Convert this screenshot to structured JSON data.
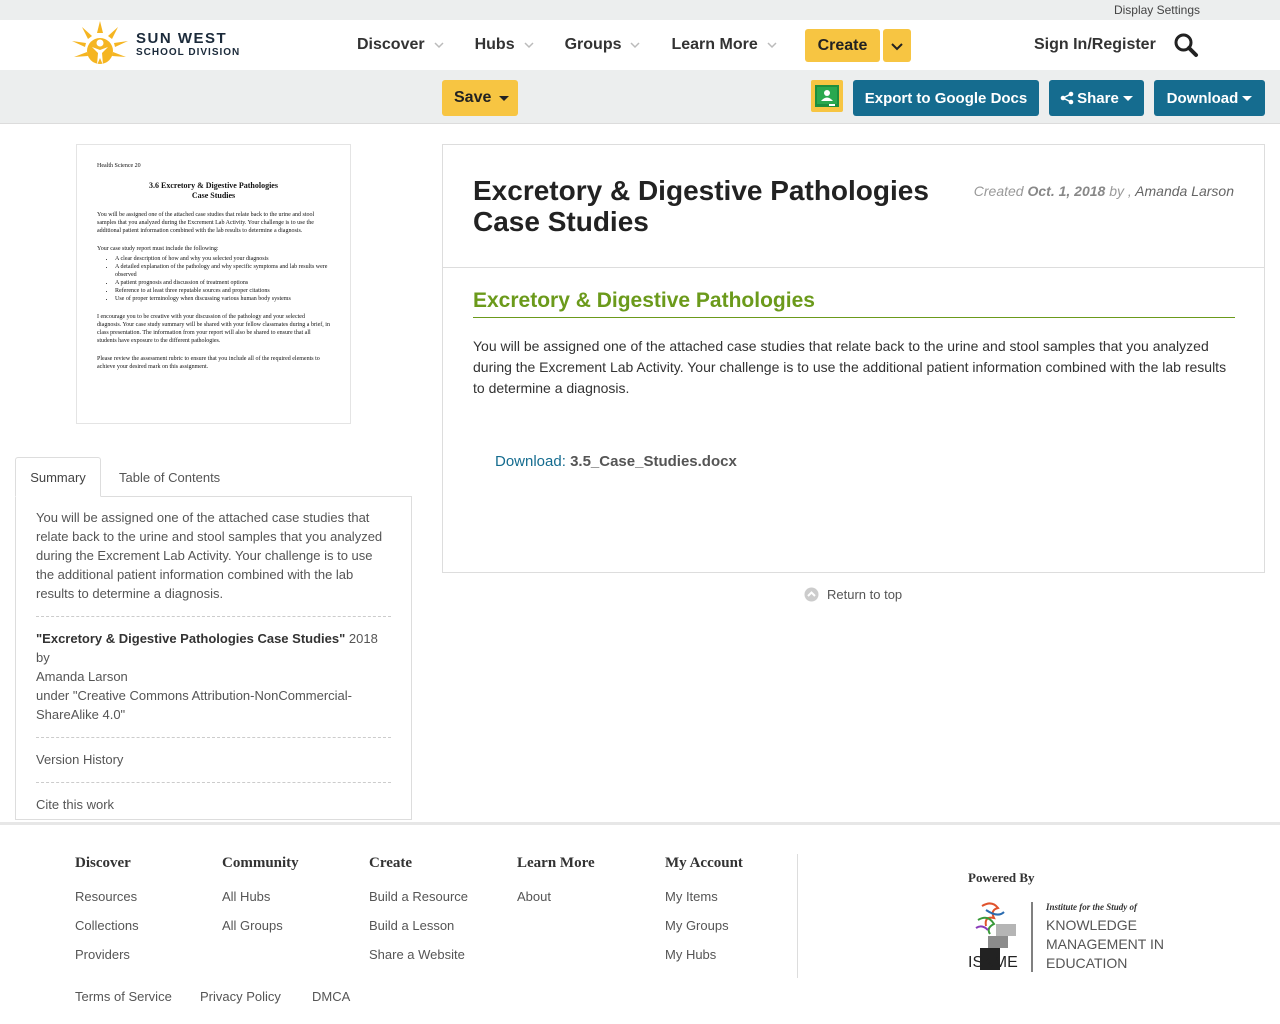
{
  "topbar": {
    "display_settings": "Display Settings"
  },
  "header": {
    "logo": {
      "line1": "SUN WEST",
      "line2": "SCHOOL DIVISION"
    },
    "nav": [
      "Discover",
      "Hubs",
      "Groups",
      "Learn More"
    ],
    "create": "Create",
    "signin": "Sign In/Register"
  },
  "toolbar": {
    "save": "Save",
    "export": "Export to Google Docs",
    "share": "Share",
    "download": "Download"
  },
  "thumbnail": {
    "course": "Health Science 20",
    "title_line1": "3.6 Excretory & Digestive Pathologies",
    "title_line2": "Case Studies",
    "para1": "You will be assigned one of the attached case studies that relate back to the urine and stool samples that you analyzed during the Excrement Lab Activity. Your challenge is to use the additional patient information combined with the lab results to determine a diagnosis.",
    "list_intro": "Your case study report must include the following:",
    "list": [
      "A clear description of how and why you selected your diagnosis",
      "A detailed explanation of the pathology and why specific symptoms and lab results were observed",
      "A patient prognosis and discussion of treatment options",
      "Reference to at least three reputable sources and proper citations",
      "Use of proper terminology when discussing various human body systems"
    ],
    "para2": "I encourage you to be creative with your discussion of the pathology and your selected diagnosis. Your case study summary will be shared with your fellow classmates during a brief, in class presentation. The information from your report will also be shared to ensure that all students have exposure to the different pathologies.",
    "para3": "Please review the assessment rubric to ensure that you include all of the required elements to achieve your desired mark on this assignment."
  },
  "sidebar": {
    "tabs": [
      "Summary",
      "Table of Contents"
    ],
    "summary": "You will be assigned one of the attached case studies that relate back to the urine and stool samples that you analyzed during the Excrement Lab Activity. Your challenge is to use the additional patient information combined with the lab results to determine a diagnosis.",
    "attribution_title": "\"Excretory & Digestive Pathologies Case Studies\"",
    "attribution_year_by": " 2018 by",
    "attribution_author": "Amanda Larson",
    "attribution_license": "under \"Creative Commons Attribution-NonCommercial-ShareAlike 4.0\"",
    "version_history": "Version History",
    "cite": "Cite this work"
  },
  "main": {
    "title": "Excretory & Digestive Pathologies Case Studies",
    "created_label": "Created",
    "created_date": "Oct. 1, 2018",
    "by_label": "by ,",
    "author": "Amanda Larson",
    "section_title": "Excretory & Digestive Pathologies",
    "body": "You will be assigned one of the attached case studies that relate back to the urine and stool samples that you analyzed during the Excrement Lab Activity. Your challenge is to use the additional patient information combined with the lab results to determine a diagnosis.",
    "download_label": "Download:",
    "download_file": "3.5_Case_Studies.docx",
    "return_top": "Return to top"
  },
  "footer": {
    "columns": [
      {
        "heading": "Discover",
        "links": [
          "Resources",
          "Collections",
          "Providers"
        ]
      },
      {
        "heading": "Community",
        "links": [
          "All Hubs",
          "All Groups"
        ]
      },
      {
        "heading": "Create",
        "links": [
          "Build a Resource",
          "Build a Lesson",
          "Share a Website"
        ]
      },
      {
        "heading": "Learn More",
        "links": [
          "About"
        ]
      },
      {
        "heading": "My Account",
        "links": [
          "My Items",
          "My Groups",
          "My Hubs"
        ]
      }
    ],
    "powered_by": "Powered By",
    "iskme": {
      "tagline": "Institute for the Study of",
      "line1": "KNOWLEDGE",
      "line2": "MANAGEMENT IN",
      "line3": "EDUCATION",
      "mark": "ISKME"
    },
    "legal": [
      "Terms of Service",
      "Privacy Policy",
      "DMCA"
    ]
  },
  "colors": {
    "accent_yellow": "#f7c542",
    "primary_blue": "#156c8f",
    "section_green": "#6b9a1b"
  }
}
